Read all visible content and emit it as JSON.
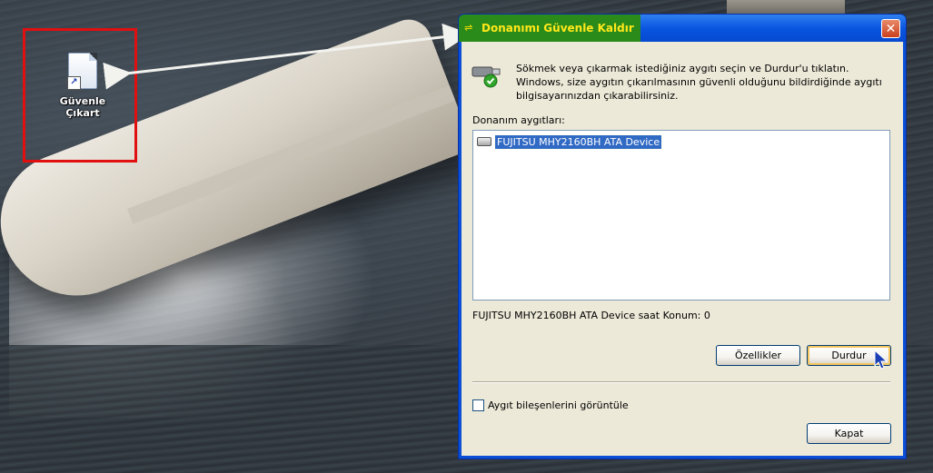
{
  "desktop": {
    "shortcut_label_line1": "Güvenle",
    "shortcut_label_line2": "Çıkart",
    "shortcut_icon": "file-shortcut-icon",
    "highlight_color": "#e01010"
  },
  "dialog": {
    "title": "Donanımı Güvenle Kaldır",
    "close_glyph": "✕",
    "intro_text": "Sökmek veya çıkarmak istediğiniz aygıtı seçin ve Durdur'u tıklatın. Windows, size aygıtın çıkarılmasının güvenli olduğunu bildirdiğinde aygıtı bilgisayarınızdan çıkarabilirsiniz.",
    "devices_label": "Donanım aygıtları:",
    "devices": [
      {
        "name": "FUJITSU MHY2160BH ATA Device",
        "icon": "hard-drive-icon",
        "selected": true
      }
    ],
    "status_text": "FUJITSU MHY2160BH ATA Device saat Konum: 0",
    "properties_button": "Özellikler",
    "stop_button": "Durdur",
    "show_components_label": "Aygıt bileşenlerini görüntüle",
    "show_components_checked": false,
    "close_button": "Kapat",
    "colors": {
      "title_bar": "#0a56e0",
      "title_highlight": "#2a8a1a",
      "title_text": "#ffe81a",
      "selection": "#316ac5"
    }
  }
}
